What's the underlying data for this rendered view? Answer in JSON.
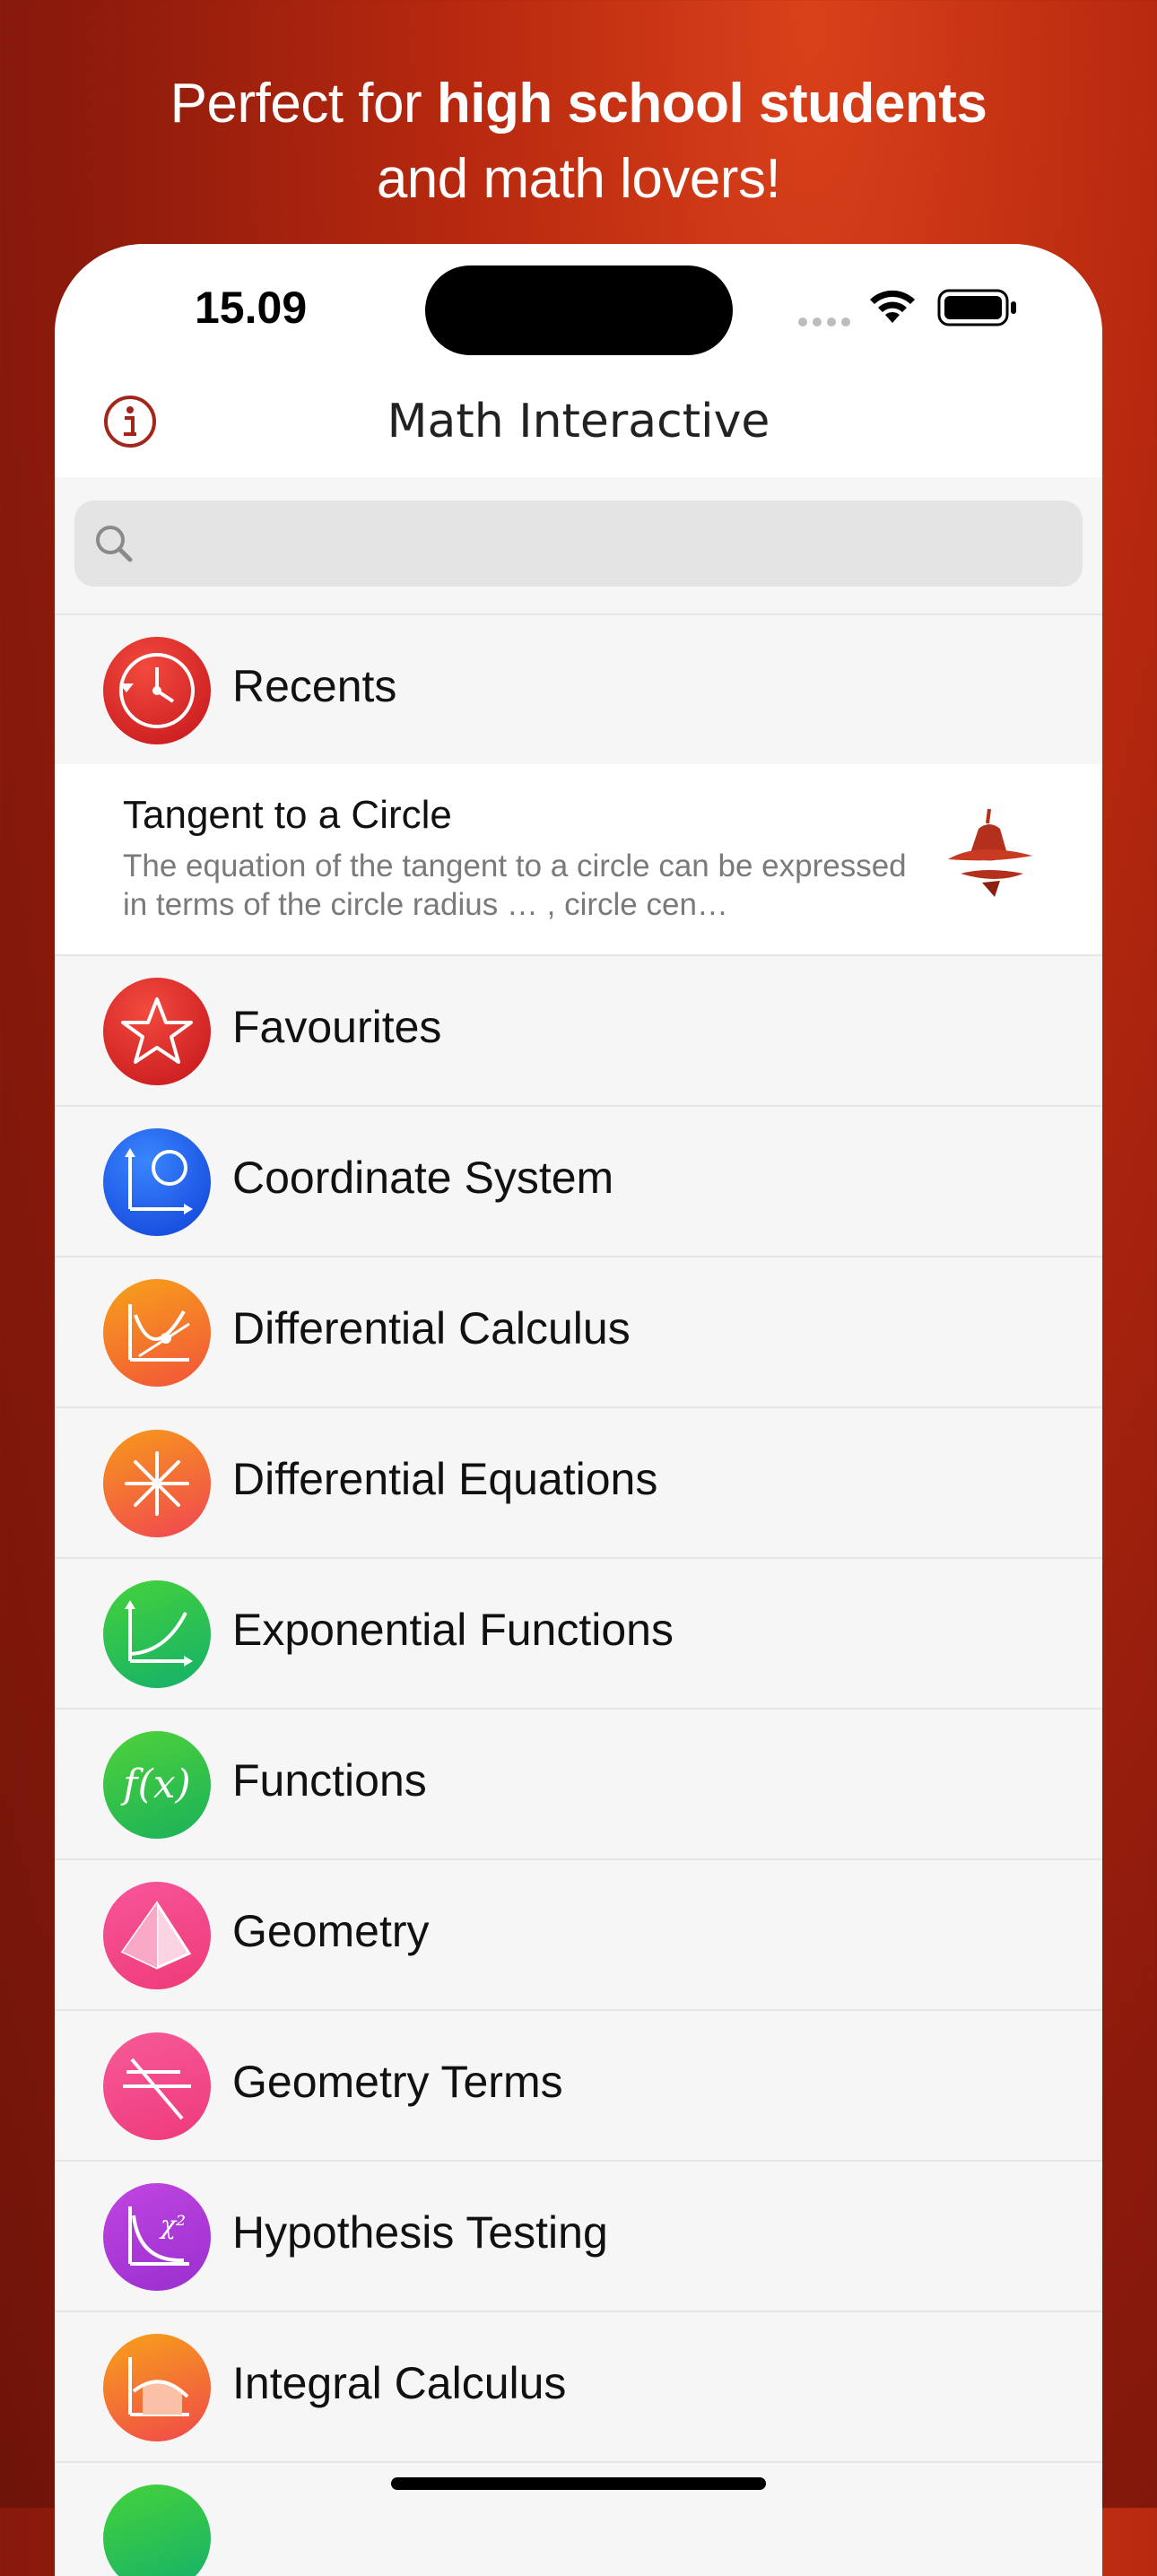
{
  "promo": {
    "line1_prefix": "Perfect for ",
    "line1_bold": "high school students",
    "line2": "and math lovers!"
  },
  "status": {
    "time": "15.09"
  },
  "nav": {
    "title": "Math Interactive",
    "info_icon": "info-icon"
  },
  "search": {
    "placeholder": "",
    "value": ""
  },
  "recents": {
    "label": "Recents",
    "item": {
      "title": "Tangent to a Circle",
      "description": "The equation of the tangent to a circle can be expressed in terms of the circle radius … , circle cen…"
    }
  },
  "categories": [
    {
      "label": "Favourites",
      "icon": "star-icon"
    },
    {
      "label": "Coordinate System",
      "icon": "coordinate-icon"
    },
    {
      "label": "Differential Calculus",
      "icon": "derivative-icon"
    },
    {
      "label": "Differential Equations",
      "icon": "vector-field-icon"
    },
    {
      "label": "Exponential Functions",
      "icon": "exponential-icon"
    },
    {
      "label": "Functions",
      "icon": "fx-icon"
    },
    {
      "label": "Geometry",
      "icon": "pyramid-icon"
    },
    {
      "label": "Geometry Terms",
      "icon": "lines-icon"
    },
    {
      "label": "Hypothesis Testing",
      "icon": "chi-square-icon"
    },
    {
      "label": "Integral Calculus",
      "icon": "integral-icon"
    }
  ],
  "colors": {
    "background": "#b8290f",
    "red": "#d0201f",
    "blue": "#1a5bf0",
    "orange": "#f3831c",
    "green": "#2dbf3b",
    "pink": "#f43a8a",
    "purple": "#b43ad8"
  }
}
